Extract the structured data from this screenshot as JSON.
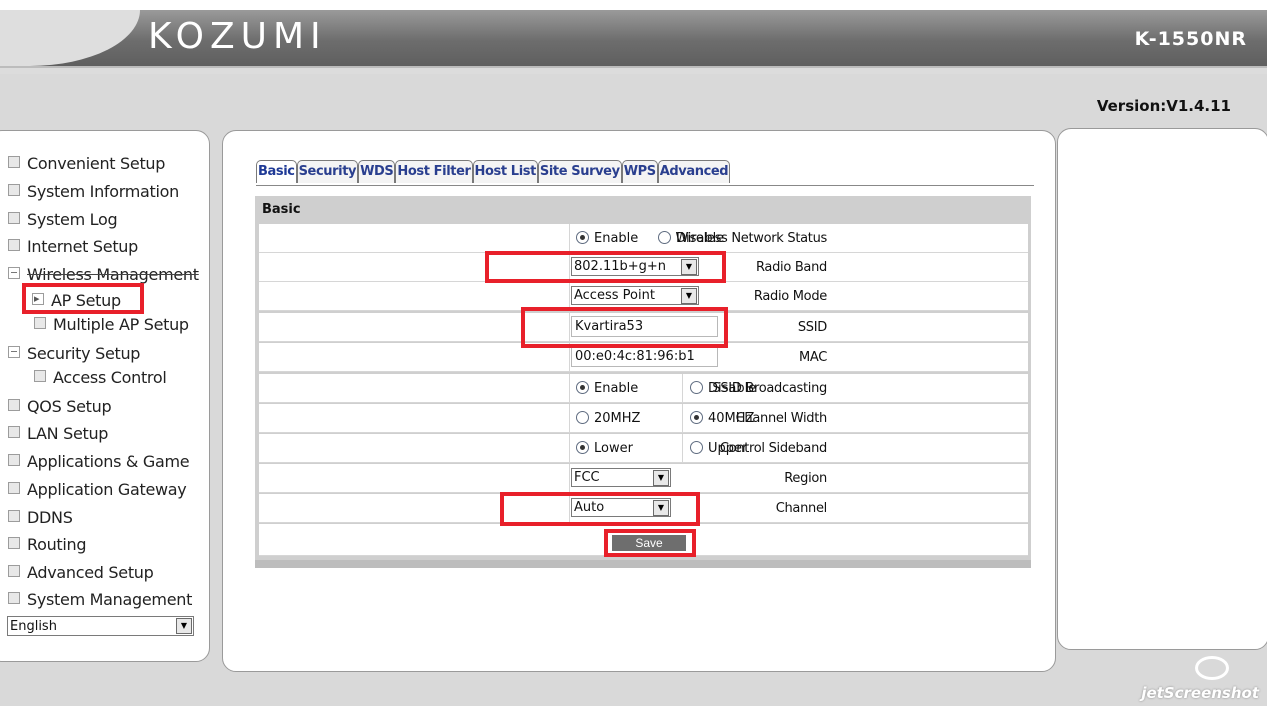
{
  "header": {
    "logo": "KOZUMI",
    "model": "K-1550NR",
    "version": "Version:V1.4.11"
  },
  "sidebar": {
    "items": [
      {
        "label": "Convenient Setup"
      },
      {
        "label": "System Information"
      },
      {
        "label": "System Log"
      },
      {
        "label": "Internet Setup"
      },
      {
        "label": "Wireless Management"
      },
      {
        "label": "AP Setup"
      },
      {
        "label": "Multiple AP Setup"
      },
      {
        "label": "Security Setup"
      },
      {
        "label": "Access Control"
      },
      {
        "label": "QOS Setup"
      },
      {
        "label": "LAN Setup"
      },
      {
        "label": "Applications & Game"
      },
      {
        "label": "Application Gateway"
      },
      {
        "label": "DDNS"
      },
      {
        "label": "Routing"
      },
      {
        "label": "Advanced Setup"
      },
      {
        "label": "System Management"
      }
    ],
    "language": "English"
  },
  "tabs": [
    "Basic",
    "Security",
    "WDS",
    "Host Filter",
    "Host List",
    "Site Survey",
    "WPS",
    "Advanced"
  ],
  "form": {
    "section_title": "Basic",
    "wireless_status": {
      "label": "Wireless Network Status",
      "opt1": "Enable",
      "opt2": "Disable"
    },
    "radio_band": {
      "label": "Radio Band",
      "value": "802.11b+g+n"
    },
    "radio_mode": {
      "label": "Radio Mode",
      "value": "Access Point"
    },
    "ssid": {
      "label": "SSID",
      "value": "Kvartira53"
    },
    "mac": {
      "label": "MAC",
      "value": "00:e0:4c:81:96:b1"
    },
    "ssid_broadcasting": {
      "label": "SSID Broadcasting",
      "opt1": "Enable",
      "opt2": "Disable"
    },
    "channel_width": {
      "label": "Channel Width",
      "opt1": "20MHZ",
      "opt2": "40MHZ"
    },
    "control_sideband": {
      "label": "Control Sideband",
      "opt1": "Lower",
      "opt2": "Upper"
    },
    "region": {
      "label": "Region",
      "value": "FCC"
    },
    "channel": {
      "label": "Channel",
      "value": "Auto"
    },
    "save_label": "Save"
  },
  "watermark": "jetScreenshot",
  "colors": {
    "highlight": "#e8202a",
    "tab_text": "#2a3f8f"
  }
}
